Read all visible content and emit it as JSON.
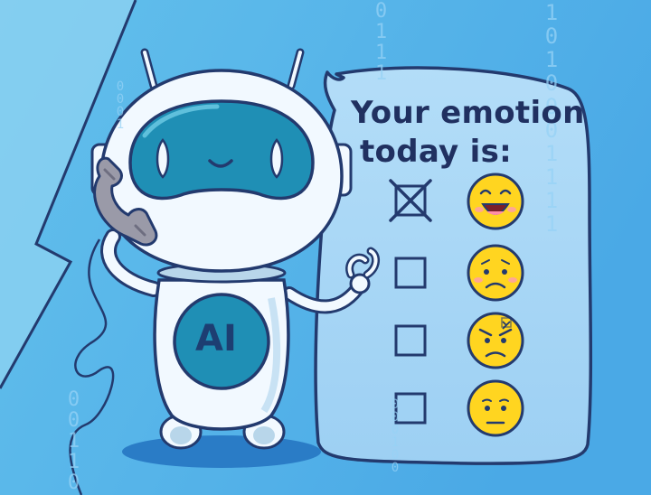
{
  "speech_bubble": {
    "title_line1": "Your emotion",
    "title_line2": "today is:"
  },
  "robot": {
    "chest_label": "AI"
  },
  "background_binary": {
    "top_center": "0111",
    "right_top": "1010001111",
    "left_small": "0001",
    "left_bottom": "00110",
    "bottom_center": "000100"
  },
  "emotion_options": [
    {
      "emotion": "happy",
      "checked": true
    },
    {
      "emotion": "sad",
      "checked": false
    },
    {
      "emotion": "angry",
      "checked": false
    },
    {
      "emotion": "neutral",
      "checked": false
    }
  ],
  "colors": {
    "background": "#5bb8ea",
    "outline": "#233a6e",
    "bubble_fill": "#a6d6f6",
    "robot_body": "#f2f9ff",
    "robot_visor": "#1f8fb5",
    "robot_chest": "#1f8fb5",
    "emoji_face": "#ffd520",
    "phone": "#9a9aa8"
  }
}
